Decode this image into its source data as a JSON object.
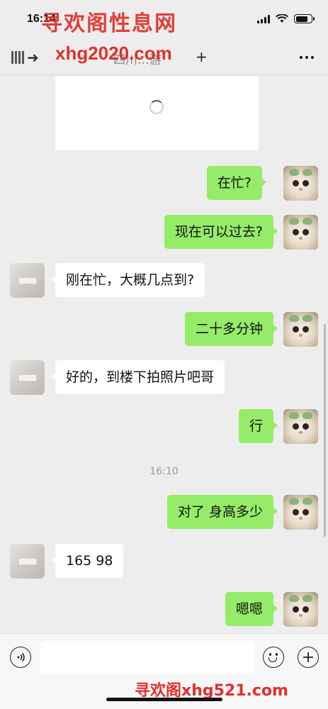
{
  "status_bar": {
    "time": "16:14"
  },
  "watermarks": {
    "top": "寻欢阁性息网",
    "url": "xhg2020.com",
    "bottom": "寻欢阁xhg521.com"
  },
  "nav": {
    "title": "四川…游",
    "plus": "+"
  },
  "messages": [
    {
      "side": "sent",
      "text": "在忙?"
    },
    {
      "side": "sent",
      "text": "现在可以过去?"
    },
    {
      "side": "recv",
      "text": "刚在忙，大概几点到?"
    },
    {
      "side": "sent",
      "text": "二十多分钟"
    },
    {
      "side": "recv",
      "text": "好的，到楼下拍照片吧哥"
    },
    {
      "side": "sent",
      "text": "行"
    },
    {
      "side": "time",
      "text": "16:10"
    },
    {
      "side": "sent",
      "text": "对了 身高多少"
    },
    {
      "side": "recv",
      "text": "165 98"
    },
    {
      "side": "sent",
      "text": "嗯嗯"
    }
  ],
  "input": {
    "placeholder": ""
  },
  "icons": {
    "voice": "voice-icon",
    "emoji": "emoji-icon",
    "plus": "plus-icon",
    "back": "back-icon",
    "more": "more-icon"
  }
}
